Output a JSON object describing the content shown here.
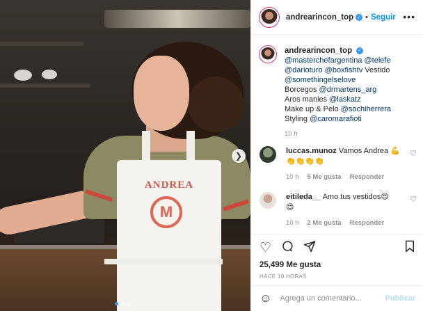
{
  "post": {
    "username": "andrearincon_top",
    "follow_label": "Seguir",
    "more_glyph": "•••",
    "separator": "•",
    "apron_name": "ANDREA",
    "apron_logo_letter": "M"
  },
  "caption": {
    "username": "andrearincon_top",
    "mention1": "@masterchefargentina",
    "mention2": "@telefe",
    "mention3": "@darioturo",
    "mention4": "@boxfishtv",
    "text_vestido": "Vestido",
    "mention5": "@somethingelselove",
    "text_borcegos": "Borcegos",
    "mention6": "@drmartens_arg",
    "text_aros": "Aros manies",
    "mention7": "@laskatz",
    "text_makeup": "Make up & Pelo",
    "mention8": "@sochiherrera",
    "text_styling": "Styling",
    "mention9": "@caromarafioti",
    "time": "10 h"
  },
  "comments": [
    {
      "username": "luccas.munoz",
      "text": "Vamos Andrea 💪",
      "text2": "👏👏👏👏",
      "time": "10 h",
      "likes": "5 Me gusta",
      "reply": "Responder"
    },
    {
      "username": "eitileda__",
      "text": "Amo tus vestidos😍",
      "text2": "😍",
      "time": "10 h",
      "likes": "2 Me gusta",
      "reply": "Responder"
    }
  ],
  "actions": {
    "likes_count": "25,499 Me gusta",
    "posted_ago": "HACE 10 HORAS"
  },
  "add_comment": {
    "placeholder": "Agrega un comentario...",
    "publish_label": "Publicar"
  },
  "icons": {
    "verified": "verified-badge-icon",
    "like": "heart-outline-icon",
    "comment": "comment-bubble-icon",
    "share": "paper-plane-icon",
    "save": "bookmark-icon",
    "emoji": "smiley-icon",
    "carousel_next": "chevron-right-icon"
  },
  "colors": {
    "link_blue": "#0095f6",
    "mention_blue": "#00376b",
    "muted_gray": "#8e8e8e",
    "publish_disabled": "#b2dffc",
    "carousel_dot_active": "#3897f0"
  }
}
